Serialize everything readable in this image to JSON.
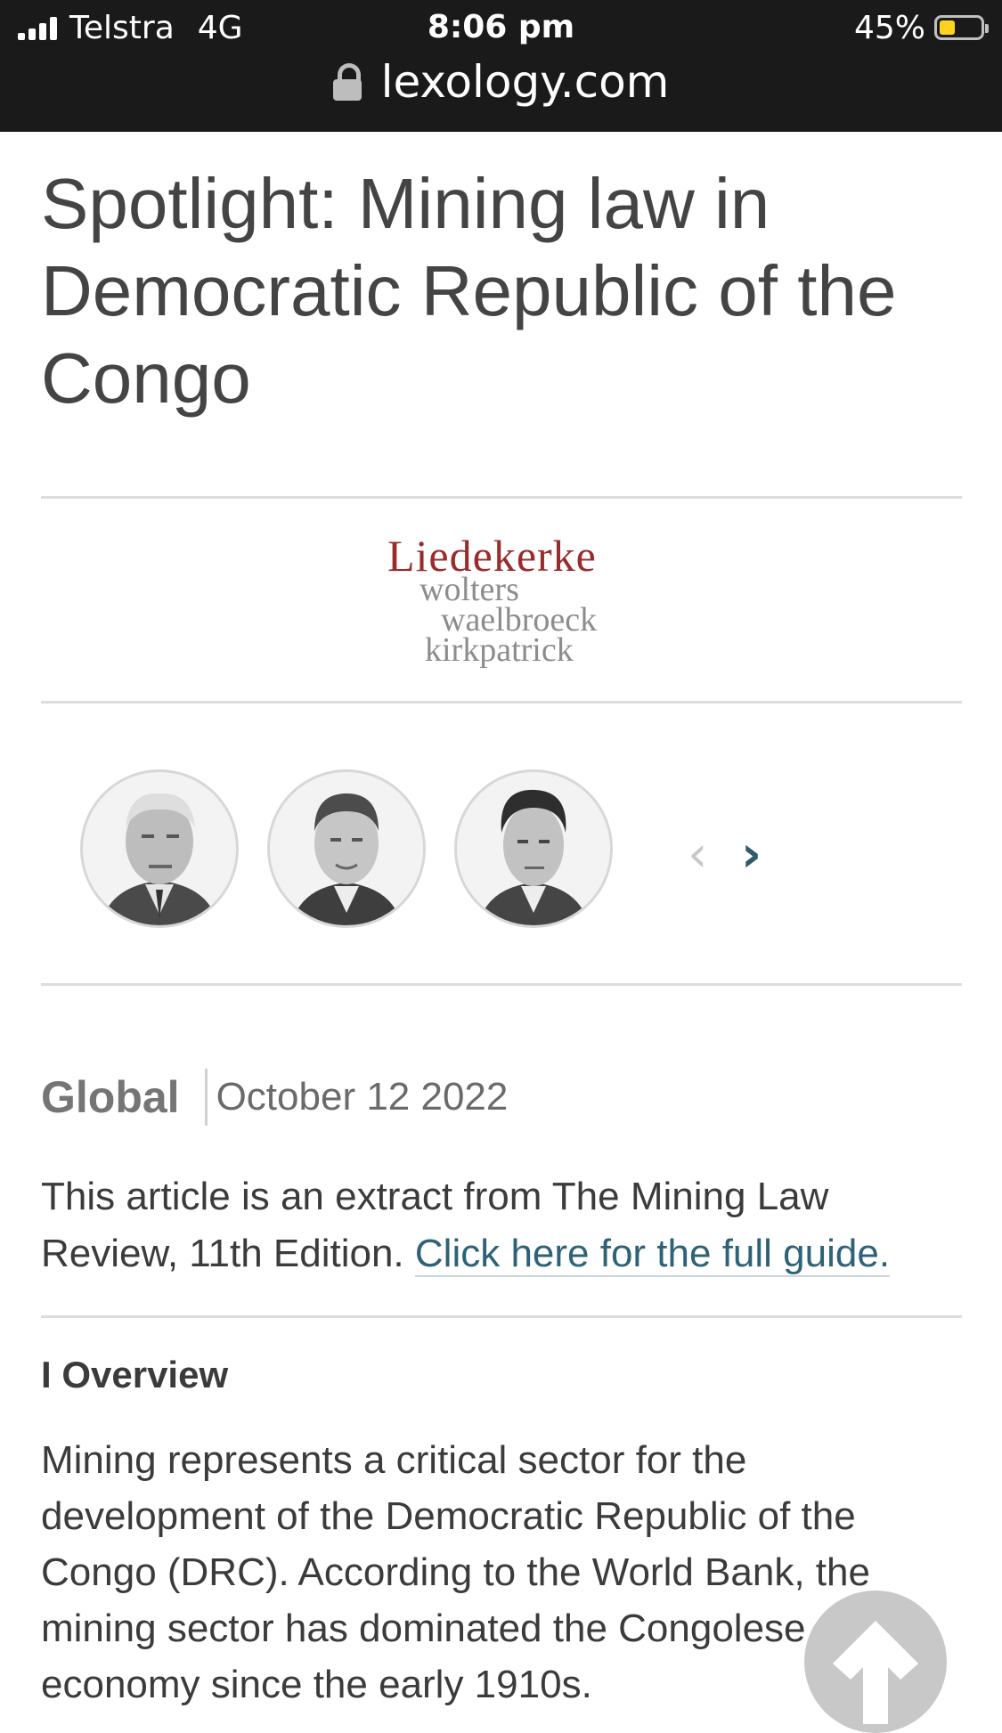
{
  "status_bar": {
    "carrier": "Telstra",
    "network": "4G",
    "time": "8:06 pm",
    "battery_percent": "45%",
    "battery_level": 0.45,
    "battery_color": "#ffd21e"
  },
  "url_bar": {
    "domain": "lexology.com"
  },
  "article": {
    "title": "Spotlight: Mining law in Democratic Republic of the Congo",
    "firm_logo": {
      "line1": "Liedekerke",
      "line2": "wolters",
      "line3": "waelbroeck",
      "line4": "kirkpatrick"
    },
    "authors_carousel": {
      "prev_icon": "chevron-left-icon",
      "next_icon": "chevron-right-icon",
      "prev_glyph": "‹",
      "next_glyph": "›"
    },
    "region": "Global",
    "date": "October 12 2022",
    "intro_text": "This article is an extract from The Mining Law Review, 11th Edition.",
    "intro_link": "Click here for the full guide.",
    "section_heading": "I Overview",
    "body": "Mining represents a critical sector for the development of the Democratic Republic of the Congo (DRC). According to the World Bank, the mining sector has dominated the Congolese economy since the early 1910s."
  },
  "colors": {
    "link": "#2e6276",
    "logo_red": "#9b2b2b",
    "next_arrow": "#2f5b6a"
  },
  "scroll_top_icon": "arrow-up-icon"
}
